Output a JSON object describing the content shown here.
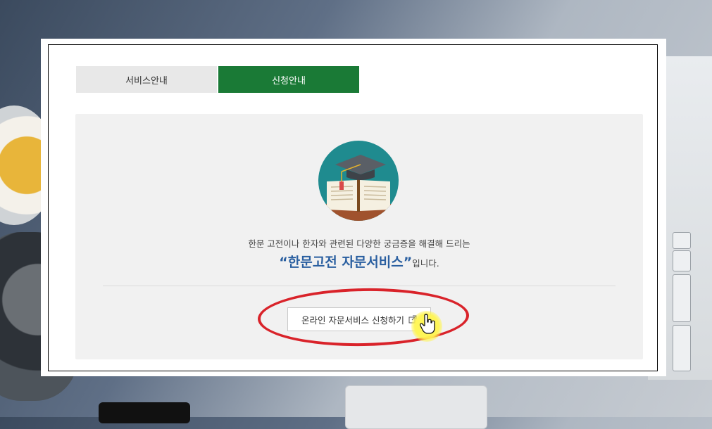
{
  "tabs": [
    {
      "label": "서비스안내",
      "active": false
    },
    {
      "label": "신청안내",
      "active": true
    }
  ],
  "intro_text": "한문 고전이나 한자와 관련된 다양한 궁금증을 해결해 드리는",
  "headline": "“한문고전 자문서비스”",
  "headline_suffix": "입니다.",
  "apply_button": {
    "label": "온라인 자문서비스 신청하기",
    "icon": "external-link-icon"
  },
  "colors": {
    "tab_active": "#1a7a36",
    "headline": "#2a5fa0",
    "highlight": "#d9232a",
    "icon_bg": "#1f8b8f"
  },
  "illustration": "graduation-cap-book-icon"
}
